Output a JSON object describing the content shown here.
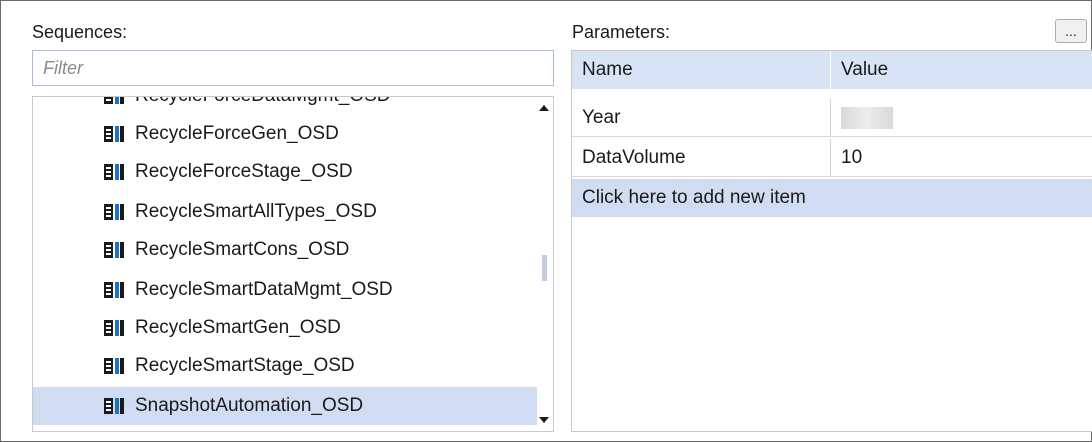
{
  "sequences": {
    "label": "Sequences:",
    "filter_placeholder": "Filter",
    "items": [
      {
        "label": "RecycleForceDataMgmt_OSD"
      },
      {
        "label": "RecycleForceGen_OSD"
      },
      {
        "label": "RecycleForceStage_OSD"
      },
      {
        "label": "RecycleSmartAllTypes_OSD"
      },
      {
        "label": "RecycleSmartCons_OSD"
      },
      {
        "label": "RecycleSmartDataMgmt_OSD"
      },
      {
        "label": "RecycleSmartGen_OSD"
      },
      {
        "label": "RecycleSmartStage_OSD"
      },
      {
        "label": "SnapshotAutomation_OSD"
      }
    ],
    "selected_index": 8,
    "item_icon": "sequence-icon"
  },
  "parameters": {
    "label": "Parameters:",
    "more_button_label": "...",
    "columns": [
      "Name",
      "Value"
    ],
    "rows": [
      {
        "name": "Year",
        "value": ""
      },
      {
        "name": "DataVolume",
        "value": "10"
      }
    ],
    "add_item_label": "Click here to add new item"
  },
  "colors": {
    "selection": "#cfdcf2",
    "header": "#d8e3f5",
    "icon_blue": "#1e73be",
    "icon_dark": "#1a1a1a"
  }
}
